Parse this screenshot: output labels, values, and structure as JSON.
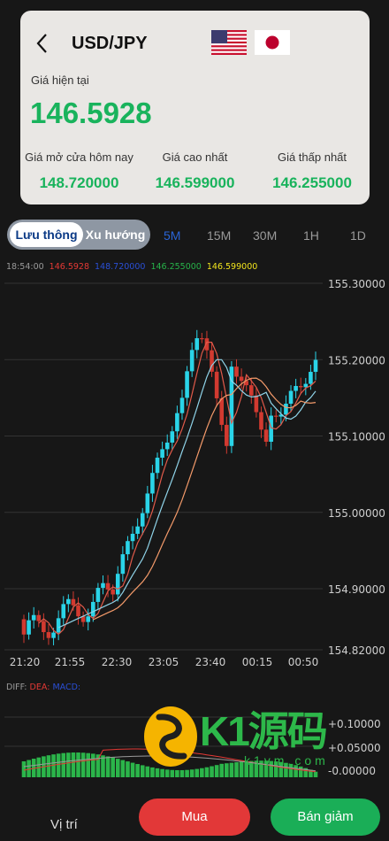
{
  "header": {
    "pair": "USD/JPY",
    "current_label": "Giá hiện tại",
    "current_price": "146.5928",
    "stats": [
      {
        "label": "Giá mở cửa hôm nay",
        "value": "148.720000"
      },
      {
        "label": "Giá cao nhất",
        "value": "146.599000"
      },
      {
        "label": "Giá thấp nhất",
        "value": "146.255000"
      }
    ]
  },
  "mode": {
    "active": "Lưu thông",
    "inactive": "Xu hướng"
  },
  "timeframes": [
    "5M",
    "15M",
    "30M",
    "1H",
    "1D"
  ],
  "active_timeframe": "5M",
  "info_row": {
    "time": "18:54:00",
    "v1": "146.5928",
    "v2": "148.720000",
    "v3": "146.255000",
    "v4": "146.599000",
    "colors": {
      "time": "#9a9a9a",
      "v1": "#e53935",
      "v2": "#2a4fd6",
      "v3": "#27b34a",
      "v4": "#f2e51d"
    }
  },
  "chart_data": {
    "type": "candlestick",
    "y_ticks": [
      "155.30000",
      "155.20000",
      "155.10000",
      "155.00000",
      "154.90000",
      "154.82000"
    ],
    "x_ticks": [
      "21:20",
      "21:55",
      "22:30",
      "23:05",
      "23:40",
      "00:15",
      "00:50"
    ],
    "ylim": [
      154.82,
      155.3
    ],
    "colors": {
      "up": "#2ad4e8",
      "down": "#d23a30"
    }
  },
  "macd": {
    "labels": {
      "diff": "DIFF:",
      "dea": "DEA:",
      "macd": "MACD:"
    },
    "y_ticks": [
      "+0.10000",
      "+0.05000",
      "-0.00000"
    ],
    "colors": {
      "diff": "#9a9a9a",
      "dea": "#e53935",
      "macd": "#2a4fd6"
    }
  },
  "watermark": {
    "text": "K1源码",
    "sub": "k1ym.com"
  },
  "footer": {
    "position": "Vị trí",
    "buy": "Mua",
    "sell": "Bán giảm"
  }
}
